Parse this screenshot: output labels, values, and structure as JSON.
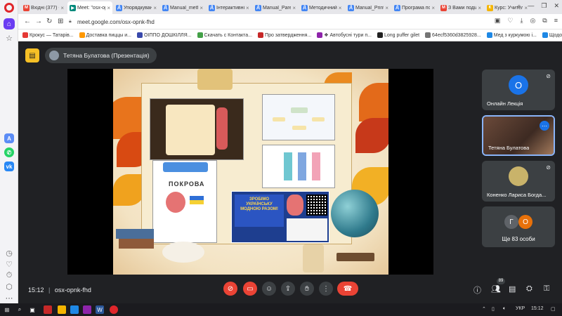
{
  "browser": {
    "tabs": [
      {
        "label": "Вхідні (377) -",
        "favicon": "gmail-icon",
        "color": "#ea4335",
        "letter": "M"
      },
      {
        "label": "Meet: \"osx-opnk-",
        "favicon": "meet-icon",
        "color": "#00897b",
        "letter": "▶",
        "active": true
      },
      {
        "label": "Упорядкуван...",
        "favicon": "doc-icon",
        "color": "#4285f4",
        "letter": "Д"
      },
      {
        "label": "Manual_meth",
        "favicon": "doc-icon",
        "color": "#4285f4",
        "letter": "Д"
      },
      {
        "label": "Інтерактивні",
        "favicon": "doc-icon",
        "color": "#4285f4",
        "letter": "Д"
      },
      {
        "label": "Manual_Paren",
        "favicon": "doc-icon",
        "color": "#4285f4",
        "letter": "Д"
      },
      {
        "label": "Методичний",
        "favicon": "doc-icon",
        "color": "#4285f4",
        "letter": "Д"
      },
      {
        "label": "Manual_Print",
        "favicon": "doc-icon",
        "color": "#4285f4",
        "letter": "Д"
      },
      {
        "label": "Програма по",
        "favicon": "doc-icon",
        "color": "#4285f4",
        "letter": "Д"
      },
      {
        "label": "З Вами поділ",
        "favicon": "gmail-icon",
        "color": "#ea4335",
        "letter": "M"
      },
      {
        "label": "Курс: Учителі",
        "favicon": "course-icon",
        "color": "#f4b400",
        "letter": "К"
      }
    ],
    "url": "meet.google.com/osx-opnk-fhd",
    "bookmarks": [
      {
        "label": "Крокус — Татарів...",
        "color": "#e53935"
      },
      {
        "label": "Доставка пиццы и...",
        "color": "#ff9800"
      },
      {
        "label": "ОІППО ДОШКІЛЛЯ...",
        "color": "#3949ab"
      },
      {
        "label": "Скачать с Контакта...",
        "color": "#43a047"
      },
      {
        "label": "Про затвердження...",
        "color": "#c62828"
      },
      {
        "label": "❖ Автобусні тури п...",
        "color": "#8e24aa"
      },
      {
        "label": "Long puffer gilet",
        "color": "#212121"
      },
      {
        "label": "64ecf5360d3825928...",
        "color": "#757575"
      },
      {
        "label": "Мед з куркумою і...",
        "color": "#1e88e5"
      },
      {
        "label": "Щодо організації в...",
        "color": "#1e88e5"
      }
    ]
  },
  "meet": {
    "presenter_label": "Тетяна Булатова (Презентація)",
    "meeting_code": "osx-opnk-fhd",
    "time": "15:12",
    "participant_count": "89",
    "slide": {
      "pokrova_title": "ПОКРОВА",
      "poster_text": "ЗРОБІМО УКРАЇНСЬКУ МОДНОЮ РАЗОМ!"
    },
    "participants": [
      {
        "name": "Онлайн Лекція",
        "avatar_letter": "О",
        "avatar_color": "#1a73e8"
      },
      {
        "name": "Тетяна Булатова",
        "active": true
      },
      {
        "name": "Коненко Лариса Богда..."
      }
    ],
    "others": {
      "label": "Ще 83 особи",
      "avatars": [
        {
          "letter": "Г",
          "color": "#5f6368"
        },
        {
          "letter": "О",
          "color": "#e8710a"
        }
      ]
    }
  },
  "taskbar": {
    "language": "УКР",
    "time": "15:12"
  }
}
